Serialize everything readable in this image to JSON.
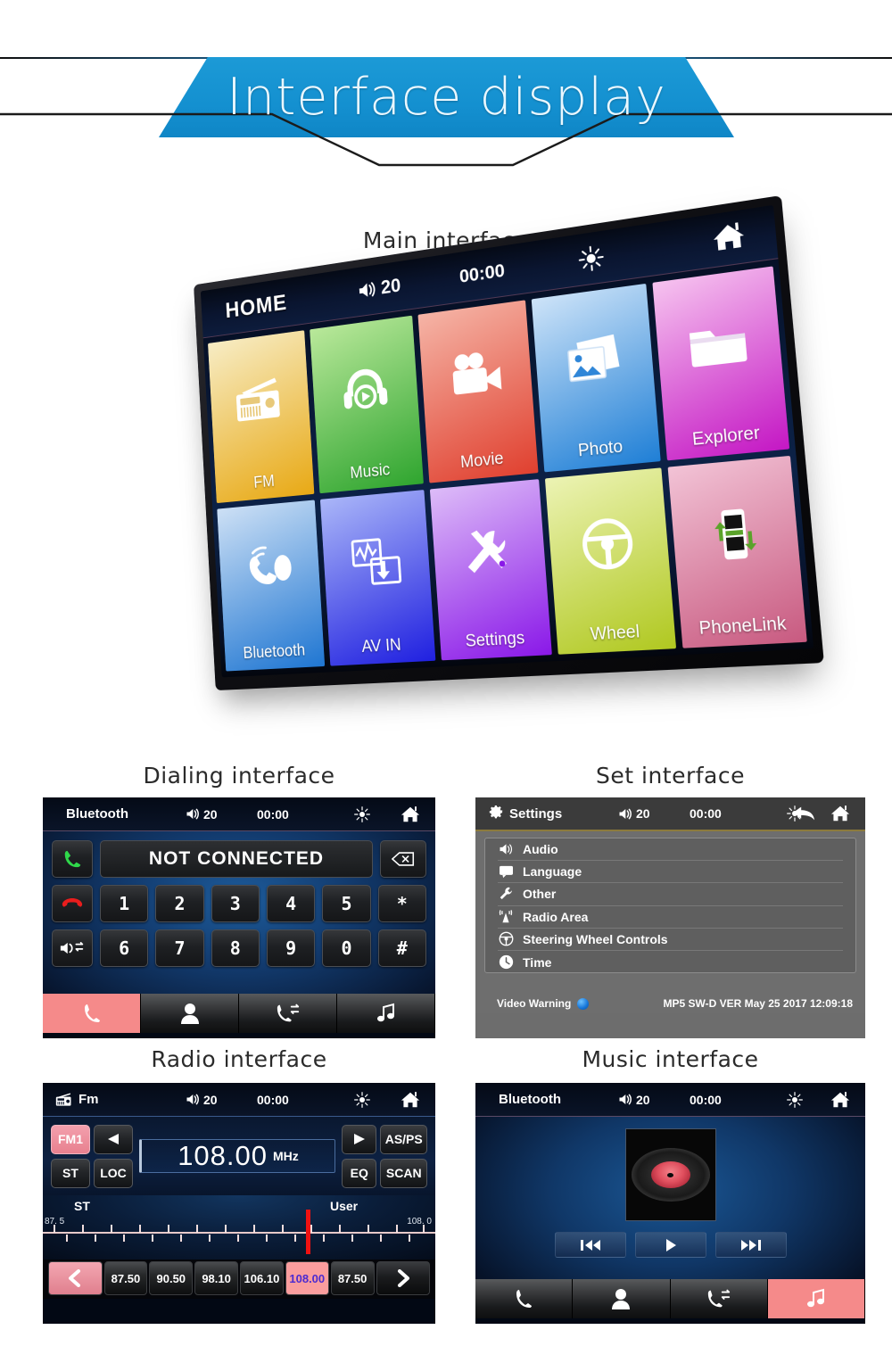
{
  "banner": {
    "title": "Interface display"
  },
  "sections": {
    "main": "Main interface",
    "dialing": "Dialing interface",
    "settings": "Set interface",
    "radio": "Radio interface",
    "music": "Music interface"
  },
  "main_interface": {
    "topbar": {
      "title": "HOME",
      "volume": "20",
      "clock": "00:00",
      "brightness_icon": "brightness-icon",
      "home_icon": "home-icon"
    },
    "tiles": [
      {
        "label": "FM",
        "icon": "radio-icon",
        "c1": "#f5e3b0",
        "c2": "#e8a915"
      },
      {
        "label": "Music",
        "icon": "headphones-icon",
        "c1": "#a7e08a",
        "c2": "#2fa52f"
      },
      {
        "label": "Movie",
        "icon": "camcorder-icon",
        "c1": "#f0a89a",
        "c2": "#e0402f"
      },
      {
        "label": "Photo",
        "icon": "photo-icon",
        "c1": "#bcd9f5",
        "c2": "#1f7fd6"
      },
      {
        "label": "Explorer",
        "icon": "folder-icon",
        "c1": "#f0b8e8",
        "c2": "#c417c4"
      },
      {
        "label": "Bluetooth",
        "icon": "bt-phone-icon",
        "c1": "#bdd9f2",
        "c2": "#1f76d2"
      },
      {
        "label": "AV IN",
        "icon": "avin-icon",
        "c1": "#9aa8f5",
        "c2": "#2020e0"
      },
      {
        "label": "Settings",
        "icon": "tools-icon",
        "c1": "#d2a8f5",
        "c2": "#8a18e8"
      },
      {
        "label": "Wheel",
        "icon": "steering-icon",
        "c1": "#e0ea9a",
        "c2": "#b0c820"
      },
      {
        "label": "PhoneLink",
        "icon": "phonelink-icon",
        "c1": "#e8a8c0",
        "c2": "#c85a80"
      }
    ]
  },
  "dialing": {
    "topbar": {
      "title": "Bluetooth",
      "volume": "20",
      "clock": "00:00"
    },
    "display": "NOT CONNECTED",
    "side_buttons": [
      "answer-call-icon",
      "end-call-icon",
      "audio-transfer-icon"
    ],
    "delete_icon": "backspace-icon",
    "keys_row1": [
      "1",
      "2",
      "3",
      "4",
      "5",
      "*"
    ],
    "keys_row2": [
      "6",
      "7",
      "8",
      "9",
      "0",
      "#"
    ],
    "nav": [
      {
        "icon": "dialpad-phone-icon",
        "active": true
      },
      {
        "icon": "contacts-icon",
        "active": false
      },
      {
        "icon": "call-history-icon",
        "active": false
      },
      {
        "icon": "music-note-icon",
        "active": false
      }
    ]
  },
  "settings": {
    "topbar": {
      "title": "Settings",
      "volume": "20",
      "clock": "00:00"
    },
    "items": [
      {
        "label": "Audio",
        "icon": "speaker-icon"
      },
      {
        "label": "Language",
        "icon": "speech-bubble-icon"
      },
      {
        "label": "Other",
        "icon": "wrench-icon"
      },
      {
        "label": "Radio Area",
        "icon": "antenna-icon"
      },
      {
        "label": "Steering Wheel Controls",
        "icon": "steering-wheel-icon"
      },
      {
        "label": "Time",
        "icon": "clock-icon"
      }
    ],
    "footer": {
      "video_warning": "Video Warning",
      "version": "MP5 SW-D VER May 25 2017 12:09:18"
    }
  },
  "radio": {
    "topbar": {
      "title": "Fm",
      "volume": "20",
      "clock": "00:00"
    },
    "band": "FM1",
    "frequency": "108.00",
    "unit": "MHz",
    "left_buttons": [
      "ST",
      "LOC"
    ],
    "right_buttons": [
      "AS/PS",
      "EQ",
      "SCAN"
    ],
    "scale": {
      "st": "ST",
      "user": "User",
      "low": "87. 5",
      "high": "108. 0",
      "cursor_pct": 67
    },
    "presets": [
      "87.50",
      "90.50",
      "98.10",
      "106.10",
      "108.00",
      "87.50"
    ],
    "selected_preset_index": 4
  },
  "music": {
    "topbar": {
      "title": "Bluetooth",
      "volume": "20",
      "clock": "00:00"
    },
    "controls": [
      "prev-track-icon",
      "play-icon",
      "next-track-icon"
    ],
    "nav": [
      {
        "icon": "dialpad-phone-icon",
        "active": false
      },
      {
        "icon": "contacts-icon",
        "active": false
      },
      {
        "icon": "call-history-icon",
        "active": false
      },
      {
        "icon": "music-note-icon",
        "active": true
      }
    ]
  },
  "colors": {
    "banner_blue": "#1490d0",
    "accent_pink": "#f58a8a",
    "settings_grey": "#6e6e6e",
    "selected_preset_text": "#4c2ad0"
  }
}
